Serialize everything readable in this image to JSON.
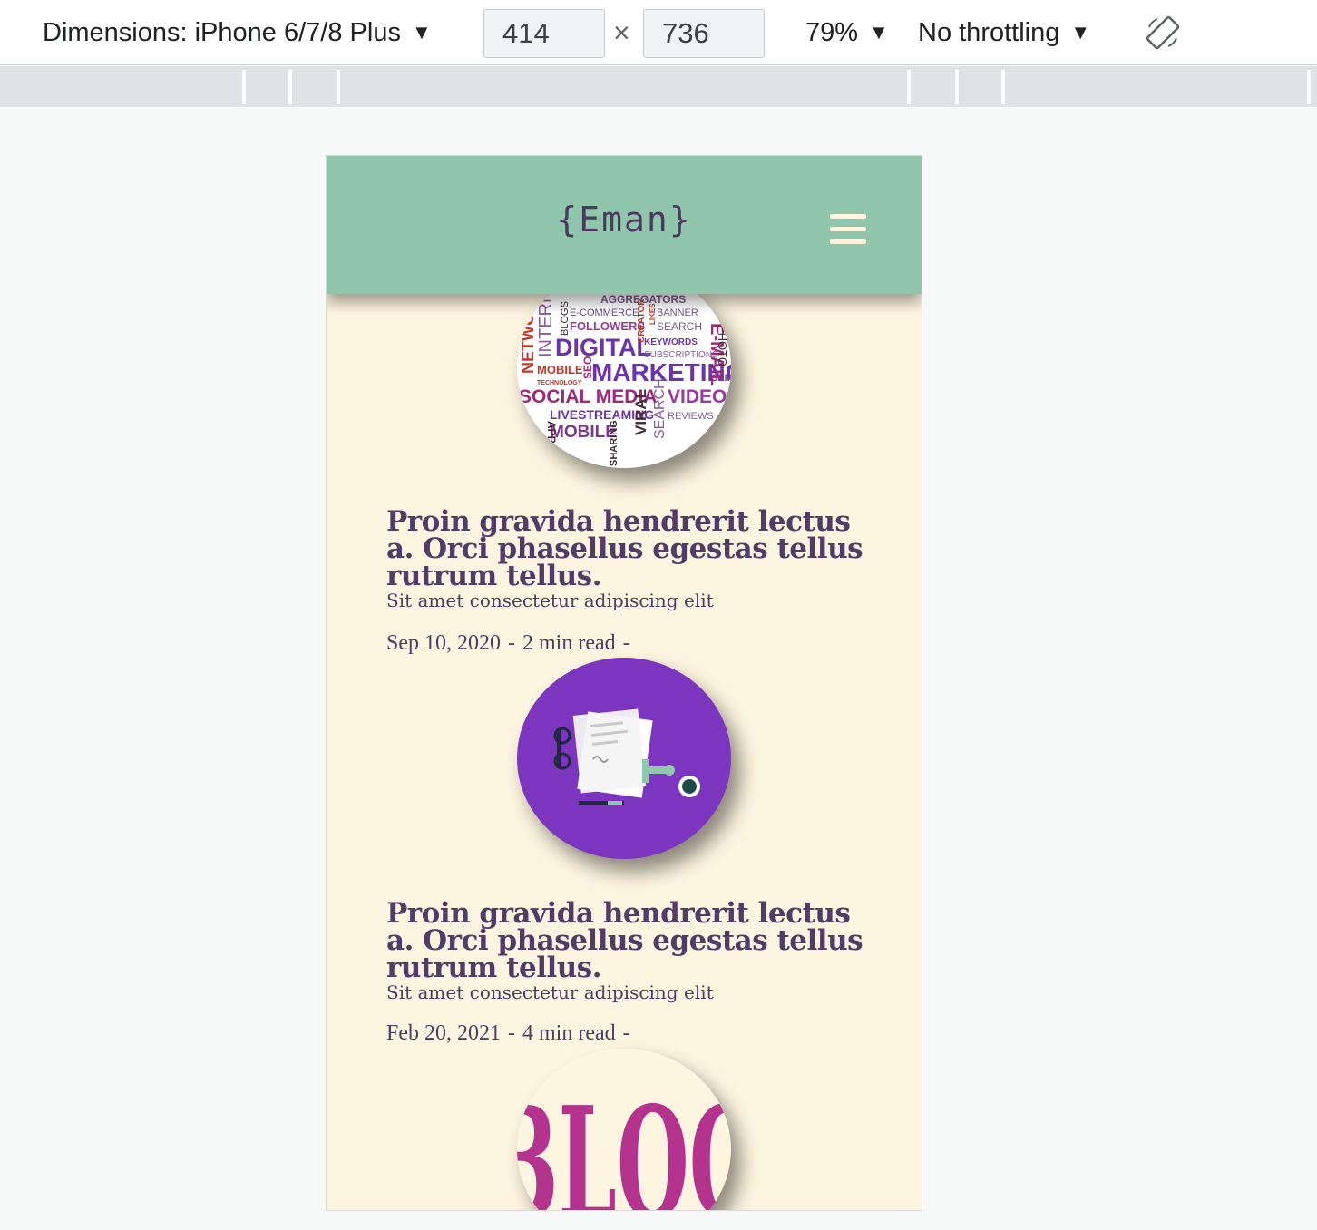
{
  "toolbar": {
    "dimensions_label": "Dimensions: iPhone 6/7/8 Plus",
    "width": "414",
    "times": "×",
    "height": "736",
    "zoom": "79%",
    "throttling": "No throttling",
    "arrow": "▼"
  },
  "site": {
    "logo": "{Eman}",
    "header_color": "#90c6ab",
    "background_color": "#fdf5df",
    "text_color": "#523b67"
  },
  "posts": [
    {
      "image": "digital-marketing-word-cloud",
      "words": [
        "AGGREGATORS",
        "E-COMMERCE",
        "BANNER",
        "FOLLOWERS",
        "SEARCH",
        "DIGITAL",
        "KEYWORDS",
        "SUBSCRIPTIONS",
        "MOBILE",
        "SEO",
        "MARKETING",
        "SOCIAL MEDIA",
        "VIDEOS",
        "LIVESTREAMING",
        "REVIEWS",
        "MOBILE",
        "VIRAL",
        "SEARCH",
        "SHARING",
        "INTERNET",
        "NETWORK",
        "BLOGS",
        "CREATOR",
        "LIKES",
        "E-MAIL",
        "PHOTO",
        "TECHNOLOGY",
        "APPS",
        "SEM"
      ]
    },
    {
      "title": "Proin gravida hendrerit lectus a. Orci phasellus egestas tellus rutrum tellus.",
      "subtitle": "Sit amet consectetur adipiscing elit",
      "date": "Sep 10, 2020",
      "read_time": "2 min read",
      "separator": "-",
      "image": "document-desk-illustration"
    },
    {
      "title": "Proin gravida hendrerit lectus a. Orci phasellus egestas tellus rutrum tellus.",
      "subtitle": "Sit amet consectetur adipiscing elit",
      "date": "Feb 20, 2021",
      "read_time": "4 min read",
      "separator": "-",
      "image": "blog-lettering",
      "image_text": "BLOG"
    }
  ]
}
